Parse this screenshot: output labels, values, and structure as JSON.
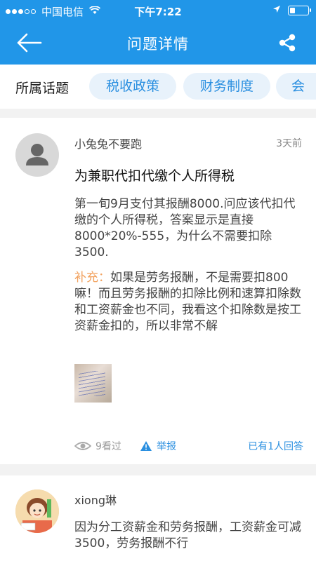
{
  "status_bar": {
    "carrier": "中国电信",
    "time": "下午7:22"
  },
  "navbar": {
    "title": "问题详情",
    "back_icon": "back-arrow-icon",
    "share_icon": "share-icon"
  },
  "topics": {
    "label": "所属话题",
    "items": [
      "税收政策",
      "财务制度",
      "会"
    ]
  },
  "question": {
    "user": "小兔兔不要跑",
    "time": "3天前",
    "title": "为兼职代扣代缴个人所得税",
    "body": "第一旬9月支付其报酬8000.问应该代扣代缴的个人所得税，答案显示是直接8000*20%-555，为什么不需要扣除3500.",
    "supplement_label": "补充：",
    "supplement": "如果是劳务报酬，不是需要扣800嘛！而且劳务报酬的扣除比例和速算扣除数和工资薪金也不同，我看这个扣除数是按工资薪金扣的，所以非常不解",
    "views": "9看过",
    "report": "举报",
    "answered": "已有1人回答"
  },
  "answer": {
    "user": "xiong琳",
    "body": "因为分工资薪金和劳务报酬，工资薪金可减3500，劳务报酬不行"
  },
  "colors": {
    "primary": "#2196e8",
    "chip_bg": "#e8f2fb",
    "link": "#2a8fe0",
    "supplement": "#f2a15d"
  }
}
